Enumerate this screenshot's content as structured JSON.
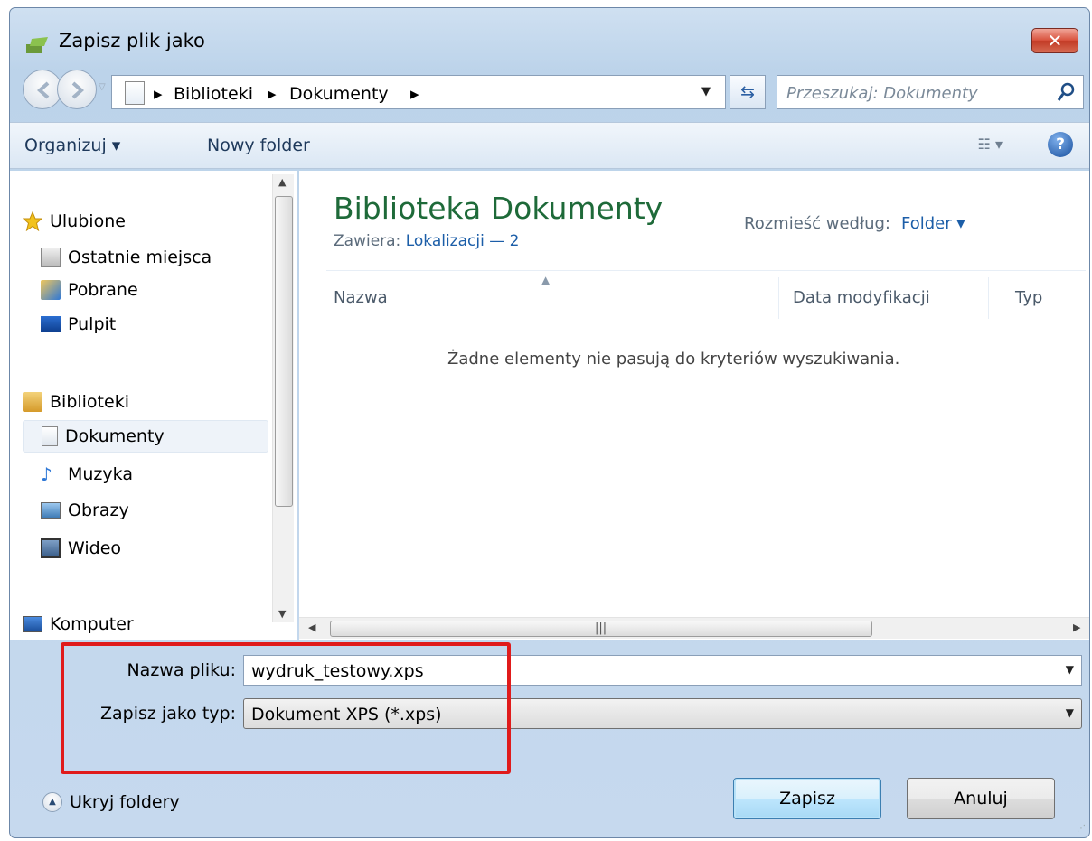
{
  "window": {
    "title": "Zapisz plik jako",
    "close_label": "✕"
  },
  "address": {
    "crumbs": [
      "Biblioteki",
      "Dokumenty"
    ],
    "separator": "▸"
  },
  "search": {
    "placeholder": "Przeszukaj: Dokumenty"
  },
  "toolbar": {
    "organize": "Organizuj ▾",
    "new_folder": "Nowy folder",
    "view_label": "☷ ▾",
    "help_label": "?"
  },
  "sidebar": {
    "items": [
      {
        "label": "Ulubione",
        "icon": "star-icon"
      },
      {
        "label": "Ostatnie miejsca",
        "icon": "recent-places-icon"
      },
      {
        "label": "Pobrane",
        "icon": "downloads-icon"
      },
      {
        "label": "Pulpit",
        "icon": "desktop-icon"
      },
      {
        "label": "Biblioteki",
        "icon": "libraries-icon"
      },
      {
        "label": "Dokumenty",
        "icon": "documents-icon",
        "selected": true
      },
      {
        "label": "Muzyka",
        "icon": "music-icon"
      },
      {
        "label": "Obrazy",
        "icon": "pictures-icon"
      },
      {
        "label": "Wideo",
        "icon": "video-icon"
      },
      {
        "label": "Komputer",
        "icon": "computer-icon"
      }
    ]
  },
  "content": {
    "title": "Biblioteka Dokumenty",
    "subtitle_prefix": "Zawiera:",
    "subtitle_link": "Lokalizacji — 2",
    "arrange_label": "Rozmieść według:",
    "arrange_value": "Folder ▾",
    "columns": [
      "Nazwa",
      "Data modyfikacji",
      "Typ"
    ],
    "empty_message": "Żadne elementy nie pasują do kryteriów wyszukiwania."
  },
  "form": {
    "filename_label": "Nazwa pliku:",
    "filename_value": "wydruk_testowy.xps",
    "filetype_label": "Zapisz jako typ:",
    "filetype_value": "Dokument XPS (*.xps)"
  },
  "footer": {
    "hide_folders": "Ukryj foldery",
    "save": "Zapisz",
    "cancel": "Anuluj"
  },
  "colors": {
    "highlight": "#e01b1b",
    "library_title": "#1e6a39",
    "link": "#1c5ea8"
  }
}
